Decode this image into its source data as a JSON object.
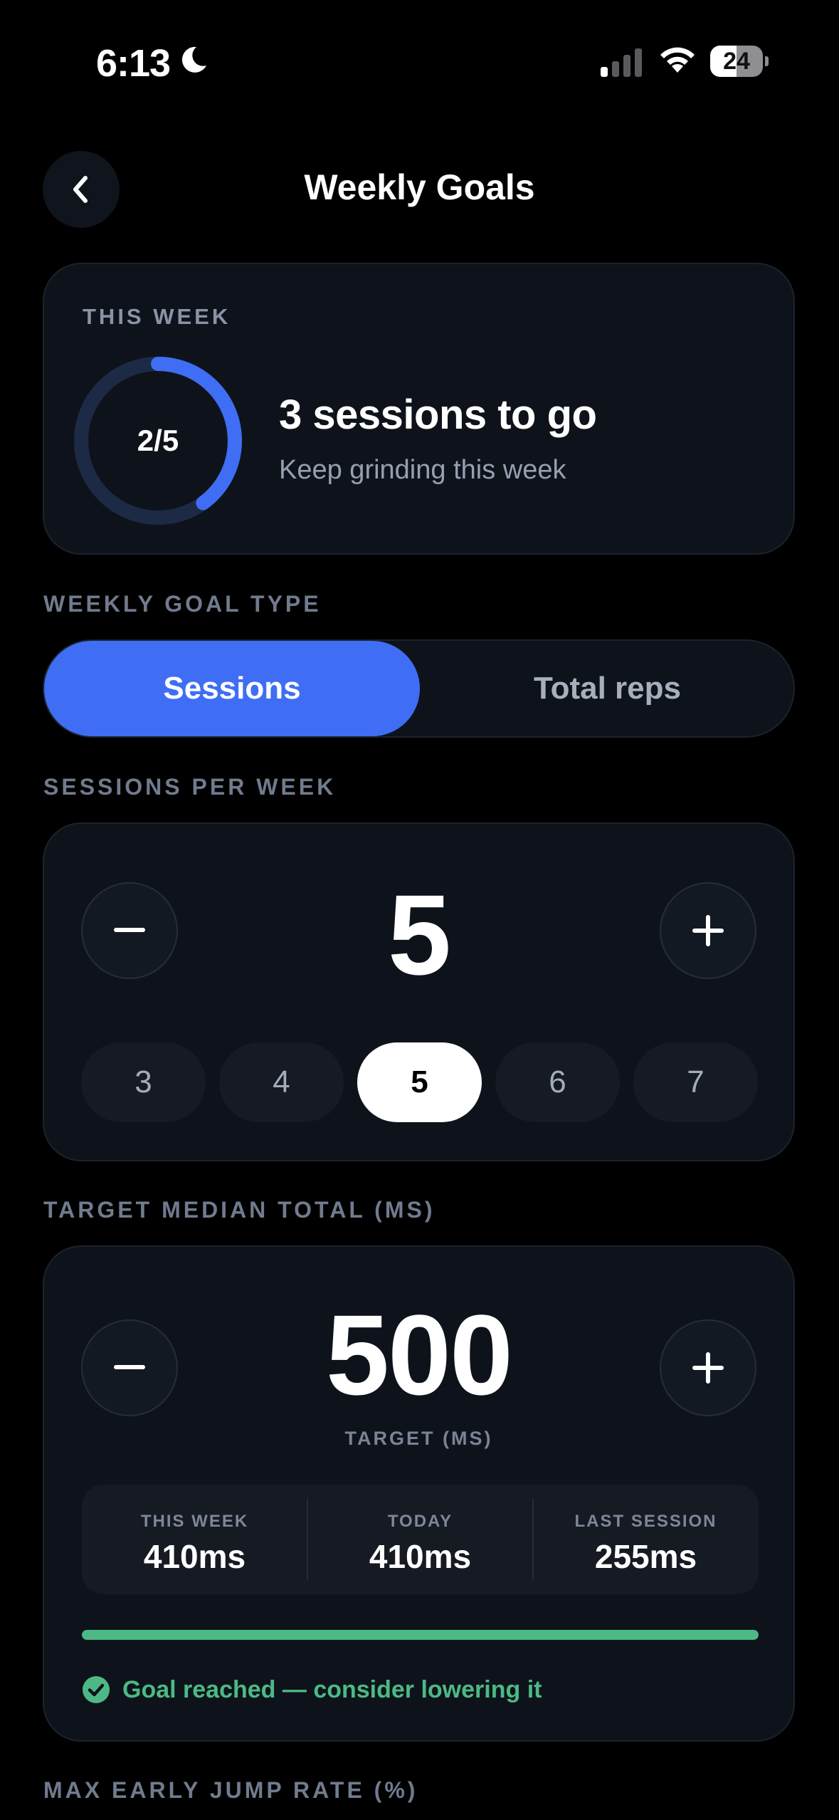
{
  "status_bar": {
    "time": "6:13",
    "battery": "24",
    "battery_level": 0.24
  },
  "header": {
    "title": "Weekly Goals"
  },
  "week_summary": {
    "label": "THIS WEEK",
    "progress_text": "2/5",
    "completed": 2,
    "goal": 5,
    "headline": "3 sessions to go",
    "subtitle": "Keep grinding this week"
  },
  "goal_type": {
    "label": "WEEKLY GOAL TYPE",
    "options": [
      "Sessions",
      "Total reps"
    ],
    "selected": "Sessions"
  },
  "sessions_per_week": {
    "label": "SESSIONS PER WEEK",
    "value": "5",
    "minus": "−",
    "plus": "+",
    "chips": [
      "3",
      "4",
      "5",
      "6",
      "7"
    ],
    "selected_chip": "5"
  },
  "target_median": {
    "label": "TARGET MEDIAN TOTAL (MS)",
    "value": "500",
    "sublabel": "TARGET (MS)",
    "stats": [
      {
        "label": "THIS WEEK",
        "value": "410ms"
      },
      {
        "label": "TODAY",
        "value": "410ms"
      },
      {
        "label": "LAST SESSION",
        "value": "255ms"
      }
    ],
    "progress": 1.0,
    "goal_message": "Goal reached — consider lowering it"
  },
  "next_section": {
    "label": "MAX EARLY JUMP RATE (%)"
  },
  "colors": {
    "accent": "#3f6ef5",
    "success": "#4cb985",
    "card": "#0e131b",
    "ring_track": "#1d2a45"
  }
}
